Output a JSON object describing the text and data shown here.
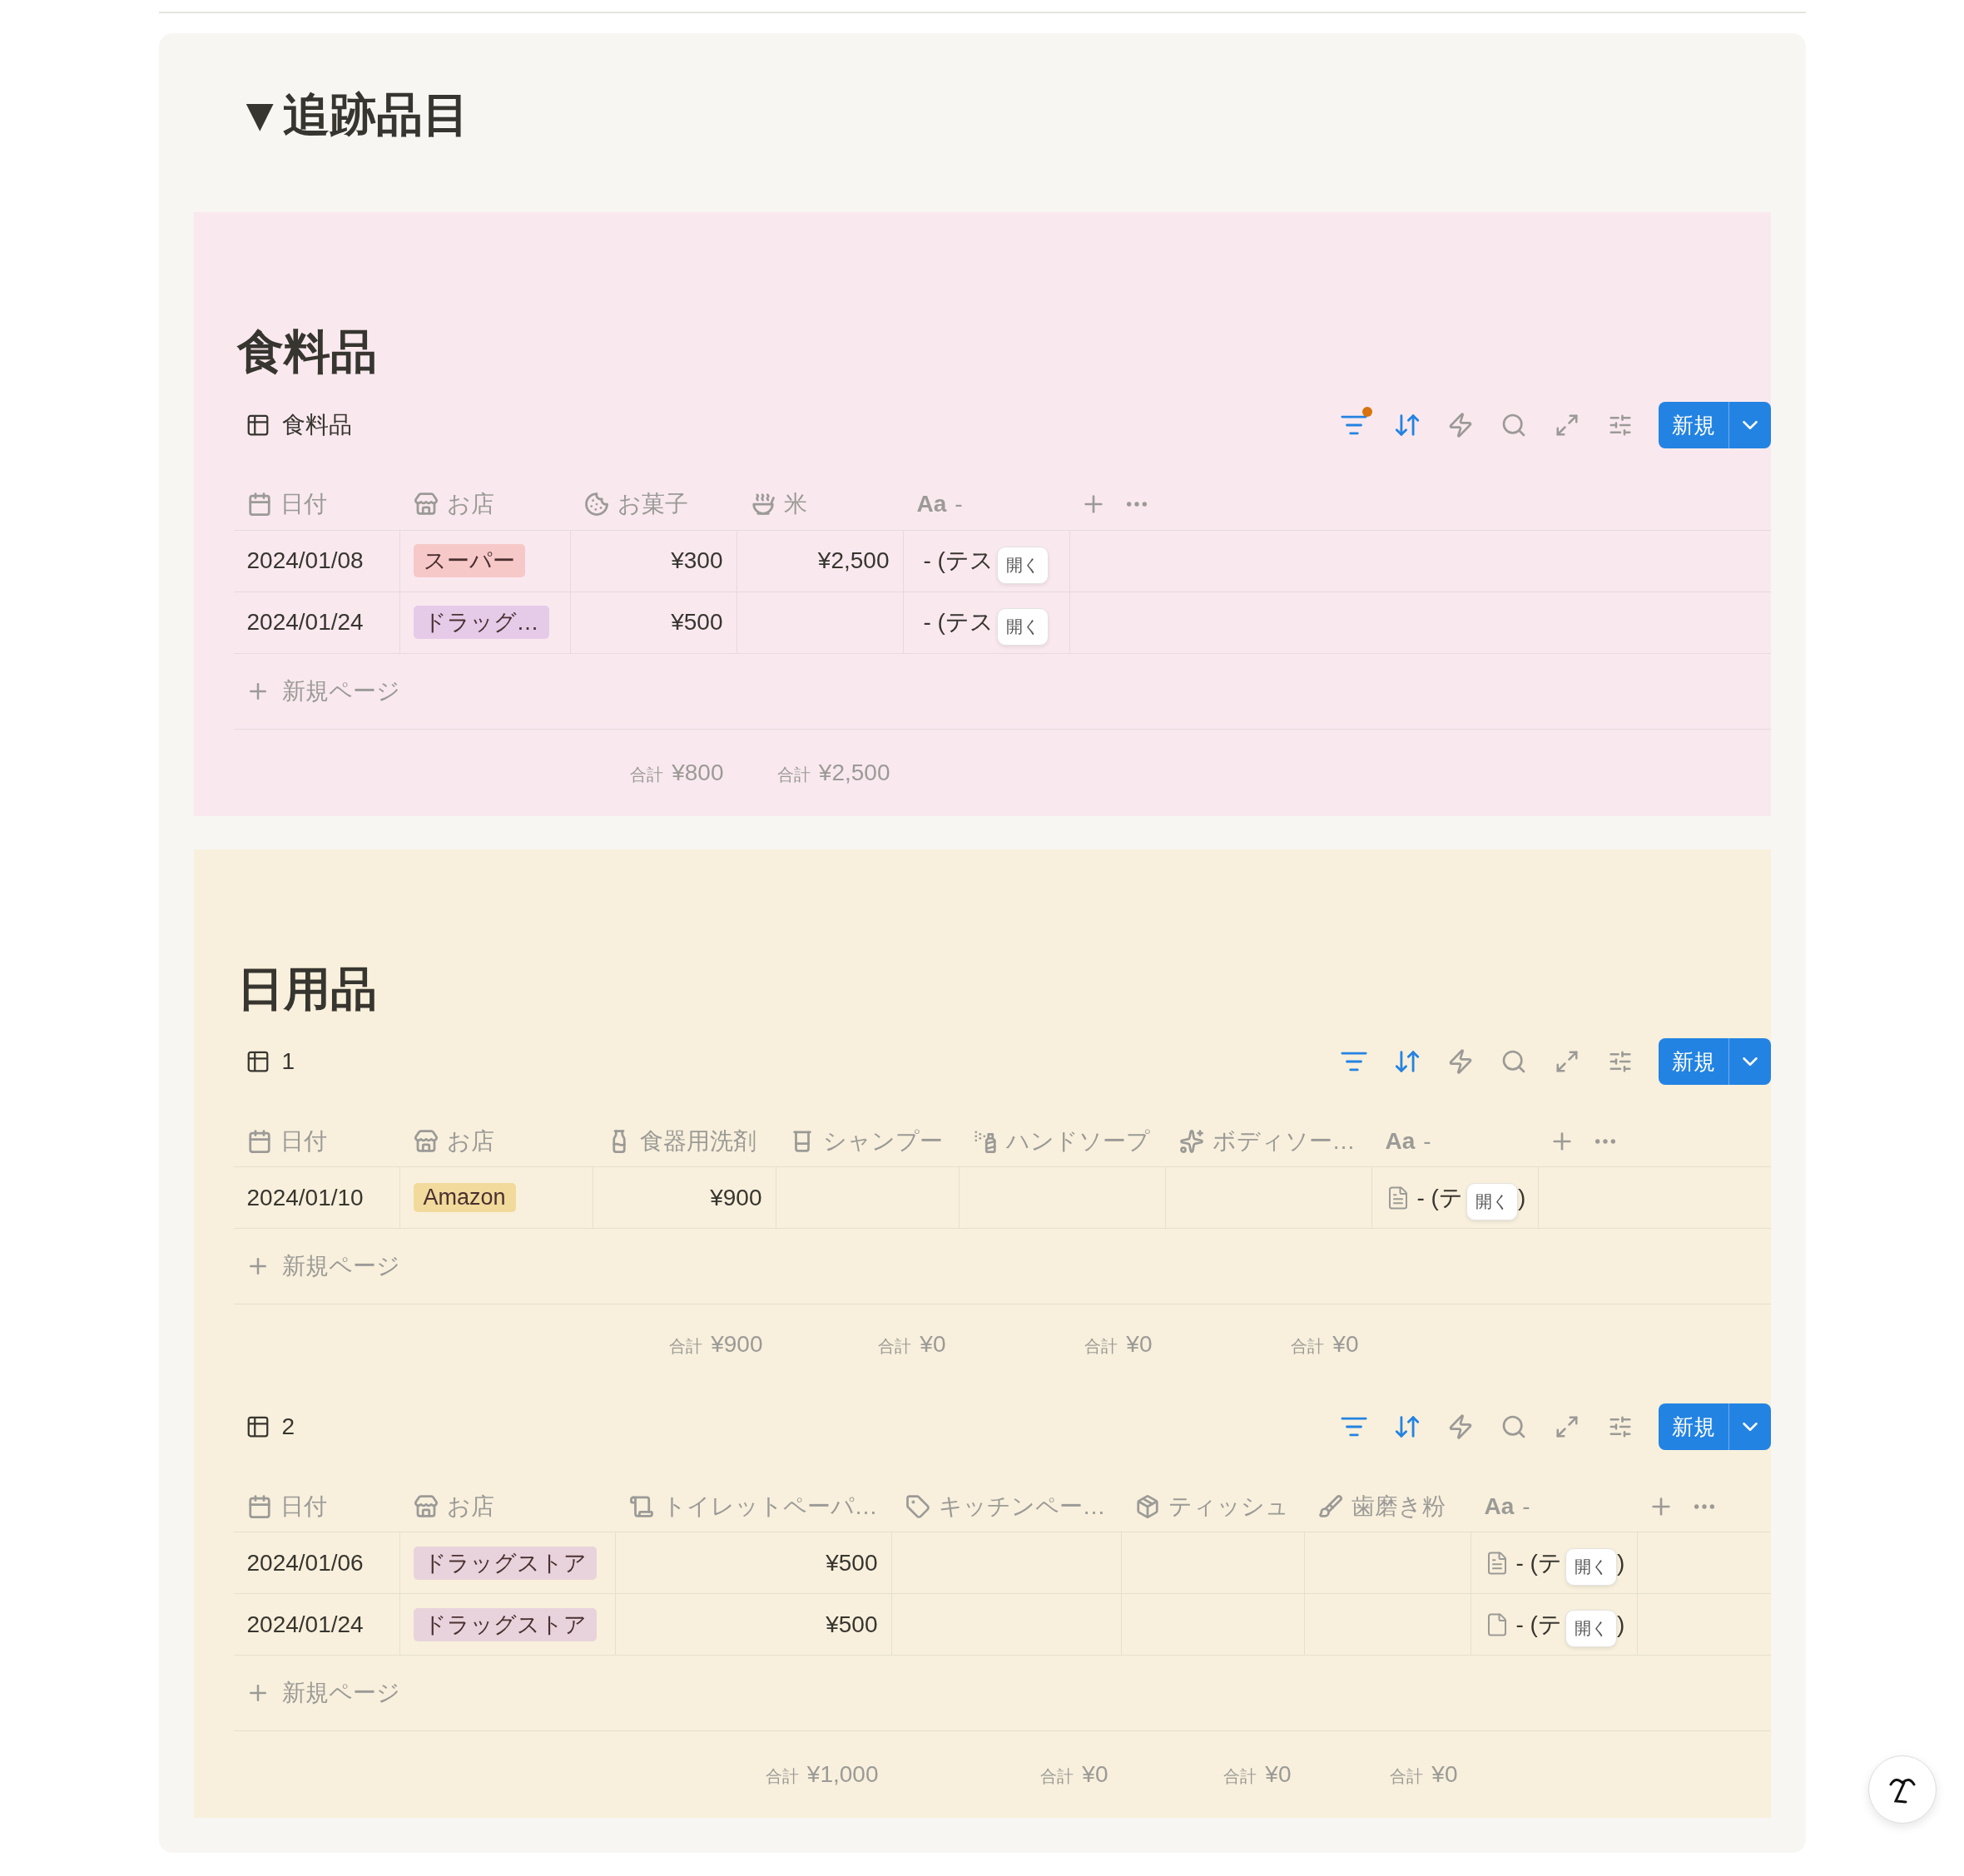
{
  "page": {
    "toggle": "▼",
    "title": "追跡品目"
  },
  "sections": [
    {
      "heading": "食料品",
      "color": "#f9e9ef",
      "databases": [
        {
          "view_name": "食料品",
          "filter_dot": true,
          "new_label": "新規",
          "new_page_label": "新規ページ",
          "columns": [
            {
              "kind": "date",
              "label": "日付"
            },
            {
              "kind": "select",
              "label": "お店"
            },
            {
              "kind": "number",
              "label": "お菓子"
            },
            {
              "kind": "number",
              "label": "米"
            },
            {
              "kind": "title",
              "glyph": "Aa",
              "label": "-"
            }
          ],
          "rows": [
            {
              "cells": [
                {
                  "text": "2024/01/08"
                },
                {
                  "text": "スーパー",
                  "color": "#f6c8c8"
                },
                {
                  "text": "¥300"
                },
                {
                  "text": "¥2,500"
                },
                {
                  "text": "- (テス",
                  "open_label": "開く"
                }
              ]
            },
            {
              "cells": [
                {
                  "text": "2024/01/24"
                },
                {
                  "text": "ドラッグ…",
                  "color": "#e5cbe8"
                },
                {
                  "text": "¥500"
                },
                {},
                {
                  "text": "- (テス",
                  "open_label": "開く"
                }
              ]
            }
          ],
          "totals": [
            {
              "label": "合計",
              "value": "¥800"
            },
            {
              "label": "合計",
              "value": "¥2,500"
            }
          ]
        }
      ]
    },
    {
      "heading": "日用品",
      "color": "#f8f0dc",
      "databases": [
        {
          "view_name": "1",
          "filter_dot": false,
          "new_label": "新規",
          "new_page_label": "新規ページ",
          "columns": [
            {
              "kind": "date",
              "label": "日付"
            },
            {
              "kind": "select",
              "label": "お店"
            },
            {
              "kind": "number",
              "label": "食器用洗剤"
            },
            {
              "kind": "number",
              "label": "シャンプー"
            },
            {
              "kind": "number",
              "label": "ハンドソープ"
            },
            {
              "kind": "number",
              "label": "ボディソー…"
            },
            {
              "kind": "title",
              "glyph": "Aa",
              "label": "-"
            }
          ],
          "rows": [
            {
              "cells": [
                {
                  "text": "2024/01/10"
                },
                {
                  "text": "Amazon",
                  "color": "#f1da9c"
                },
                {
                  "text": "¥900"
                },
                {},
                {},
                {},
                {
                  "kind": "lines",
                  "text": "- (テ",
                  "open_label": "開く",
                  "tail": ")"
                }
              ]
            }
          ],
          "totals": [
            {
              "label": "合計",
              "value": "¥900"
            },
            {
              "label": "合計",
              "value": "¥0"
            },
            {
              "label": "合計",
              "value": "¥0"
            },
            {
              "label": "合計",
              "value": "¥0"
            }
          ]
        },
        {
          "view_name": "2",
          "filter_dot": false,
          "new_label": "新規",
          "new_page_label": "新規ページ",
          "columns": [
            {
              "kind": "date",
              "label": "日付"
            },
            {
              "kind": "select",
              "label": "お店"
            },
            {
              "kind": "number",
              "label": "トイレットペーパ…"
            },
            {
              "kind": "number",
              "label": "キッチンペー…"
            },
            {
              "kind": "number",
              "label": "ティッシュ"
            },
            {
              "kind": "number",
              "label": "歯磨き粉"
            },
            {
              "kind": "title",
              "glyph": "Aa",
              "label": "-"
            }
          ],
          "rows": [
            {
              "cells": [
                {
                  "text": "2024/01/06"
                },
                {
                  "text": "ドラッグストア",
                  "color": "#e8d3dc"
                },
                {
                  "text": "¥500"
                },
                {},
                {},
                {},
                {
                  "kind": "lines",
                  "text": "- (テ",
                  "open_label": "開く",
                  "tail": ")"
                }
              ]
            },
            {
              "cells": [
                {
                  "text": "2024/01/24"
                },
                {
                  "text": "ドラッグストア",
                  "color": "#e8d3dc"
                },
                {
                  "text": "¥500"
                },
                {},
                {},
                {},
                {
                  "kind": "blank",
                  "text": "- (テ",
                  "open_label": "開く",
                  "tail": ")"
                }
              ]
            }
          ],
          "totals": [
            {
              "label": "合計",
              "value": "¥1,000"
            },
            {
              "label": "合計",
              "value": "¥0"
            },
            {
              "label": "合計",
              "value": "¥0"
            },
            {
              "label": "合計",
              "value": "¥0"
            }
          ]
        }
      ]
    }
  ]
}
